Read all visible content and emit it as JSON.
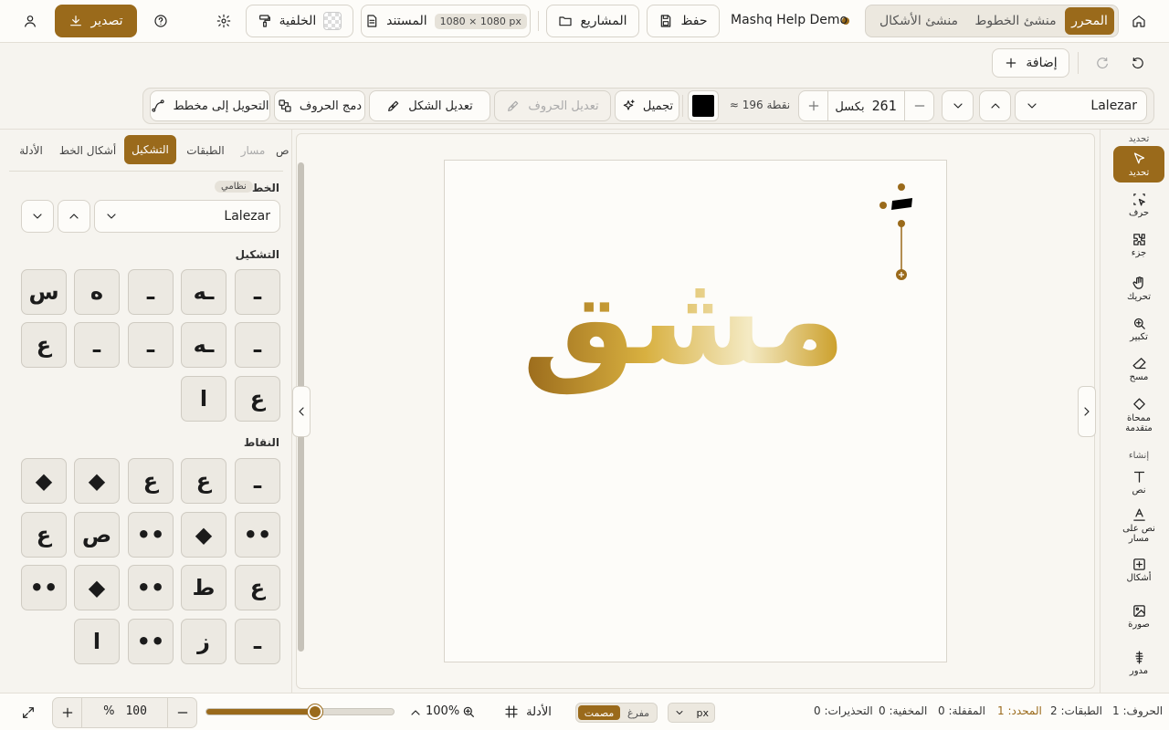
{
  "topbar": {
    "home_icon": "home-icon",
    "tabs": [
      "المحرر",
      "منشئ الخطوط",
      "منشئ الأشكال"
    ],
    "project_name": "Mashq Help Demo",
    "save_label": "حفظ",
    "projects_label": "المشاريع",
    "document_label": "المستند",
    "document_size": "1080 × 1080 px",
    "background_label": "الخلفية",
    "export_label": "تصدير"
  },
  "toolbar": {
    "add_label": "إضافة",
    "font_name": "Lalezar",
    "size_value": "261",
    "size_unit": "بكسل",
    "size_points": "≈ 196 نقطة",
    "color": "#000000",
    "beautify_label": "تجميل",
    "edit_letters_label": "تعديل الحروف",
    "edit_shape_label": "تعديل الشكل",
    "merge_letters_label": "دمج الحروف",
    "convert_path_label": "التحويل إلى مخطط"
  },
  "left_panel": {
    "tabs": [
      "الأدلة",
      "أشكال الخط",
      "التشكيل",
      "الطبقات",
      "مسار",
      "ص"
    ],
    "active_tab": "التشكيل",
    "font_section_title": "الخط",
    "font_badge": "نظامي",
    "font_name": "Lalezar",
    "tashkeel_title": "التشكيل",
    "tashkeel_glyphs": [
      "ـ",
      "ـه",
      "ـ",
      "ه",
      "س",
      "ـ",
      "ـه",
      "ـ",
      "ـ",
      "ع",
      "ع",
      "ا"
    ],
    "dots_title": "النقاط",
    "dots_glyphs": [
      "ـ",
      "ع",
      "ع",
      "◆",
      "◆",
      "••",
      "◆",
      "••",
      "ص",
      "ع",
      "ع",
      "ط",
      "••",
      "◆",
      "••",
      "ـ",
      "ز",
      "••",
      "ا"
    ]
  },
  "canvas": {
    "artwork_text": "مشق",
    "gradient_colors": [
      "#9a6a1b",
      "#d8b040",
      "#f4eac4",
      "#c8991d"
    ]
  },
  "right_tools": {
    "select_section": "تحديد",
    "tools_select": [
      {
        "label": "تحديد",
        "icon": "cursor-icon"
      },
      {
        "label": "حرف",
        "icon": "letter-select-icon"
      },
      {
        "label": "جزء",
        "icon": "part-icon"
      },
      {
        "label": "تحريك",
        "icon": "hand-icon"
      },
      {
        "label": "تكبير",
        "icon": "zoom-icon"
      },
      {
        "label": "مسح",
        "icon": "eraser-icon"
      },
      {
        "label": "ممحاة متقدمة",
        "icon": "advanced-eraser-icon"
      }
    ],
    "create_section": "إنشاء",
    "tools_create": [
      {
        "label": "نص",
        "icon": "text-icon"
      },
      {
        "label": "نص على مسار",
        "icon": "text-path-icon"
      },
      {
        "label": "أشكال",
        "icon": "shapes-icon"
      },
      {
        "label": "صورة",
        "icon": "image-icon"
      },
      {
        "label": "مدور",
        "icon": "rotate-icon"
      }
    ]
  },
  "bottombar": {
    "zoom_value": "100",
    "zoom_unit": "%",
    "zoom_display": "100%",
    "zoom_slider_fraction": 0.58,
    "guides_label": "الأدلة",
    "fill_mode_solid": "مصمت",
    "fill_mode_hollow": "مفرغ",
    "unit": "px",
    "stats": {
      "letters": "الحروف: 1",
      "layers": "الطبقات: 2",
      "selected": "المحدد: 1",
      "locked": "المقفلة: 0",
      "hidden": "المخفية: 0",
      "warnings": "التحذيرات: 0"
    }
  }
}
